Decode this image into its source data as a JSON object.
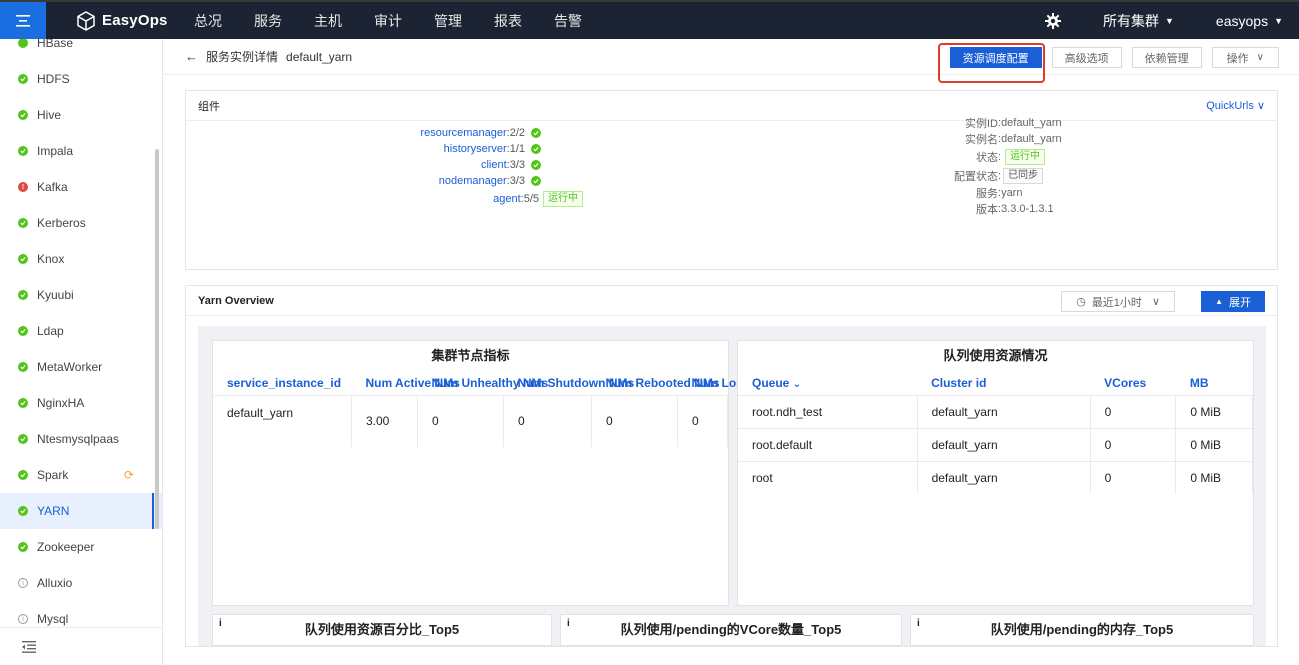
{
  "app": {
    "name": "EasyOps"
  },
  "nav": [
    "总况",
    "服务",
    "主机",
    "审计",
    "管理",
    "报表",
    "告警"
  ],
  "top_right": {
    "cluster": "所有集群",
    "user": "easyops"
  },
  "sidebar": {
    "items": [
      {
        "label": "HDFS",
        "status": "ok"
      },
      {
        "label": "Hive",
        "status": "ok"
      },
      {
        "label": "Impala",
        "status": "ok"
      },
      {
        "label": "Kafka",
        "status": "error"
      },
      {
        "label": "Kerberos",
        "status": "ok"
      },
      {
        "label": "Knox",
        "status": "ok"
      },
      {
        "label": "Kyuubi",
        "status": "ok"
      },
      {
        "label": "Ldap",
        "status": "ok"
      },
      {
        "label": "MetaWorker",
        "status": "ok"
      },
      {
        "label": "NginxHA",
        "status": "ok"
      },
      {
        "label": "Ntesmysqlpaas",
        "status": "ok"
      },
      {
        "label": "Spark",
        "status": "ok"
      },
      {
        "label": "YARN",
        "status": "ok",
        "active": true
      },
      {
        "label": "Zookeeper",
        "status": "ok"
      },
      {
        "label": "Alluxio",
        "status": "info"
      },
      {
        "label": "Mysql",
        "status": "info"
      }
    ]
  },
  "header": {
    "back_label": "服务实例详情",
    "instance": "default_yarn",
    "buttons": {
      "resource_config": "资源调度配置",
      "advanced": "高级选项",
      "dependency": "依赖管理",
      "operations": "操作"
    }
  },
  "components": {
    "title": "组件",
    "quickurls": "QuickUrls",
    "list": [
      {
        "name": "resourcemanager",
        "value": "2/2"
      },
      {
        "name": "historyserver",
        "value": "1/1"
      },
      {
        "name": "client",
        "value": "3/3"
      },
      {
        "name": "nodemanager",
        "value": "3/3"
      },
      {
        "name": "agent",
        "value": "5/5",
        "tag": "运行中"
      }
    ],
    "info": [
      {
        "key": "实例ID",
        "value": "default_yarn"
      },
      {
        "key": "实例名",
        "value": "default_yarn"
      },
      {
        "key": "状态",
        "tag": "运行中"
      },
      {
        "key": "配置状态",
        "tag": "已同步"
      },
      {
        "key": "服务",
        "value": "yarn"
      },
      {
        "key": "版本",
        "value": "3.3.0-1.3.1"
      }
    ]
  },
  "overview": {
    "title": "Yarn Overview",
    "time_range": "最近1小时",
    "expand": "展开",
    "cluster_metrics": {
      "title": "集群节点指标",
      "headers": [
        "service_instance_id",
        "Num Active NMs",
        "Num Unhealthy NMs",
        "Num Shutdown NMs",
        "Num Rebooted NMs",
        "Num Lost NMs"
      ],
      "rows": [
        [
          "default_yarn",
          "3.00",
          "0",
          "0",
          "0",
          "0"
        ]
      ]
    },
    "queue_usage": {
      "title": "队列使用资源情况",
      "headers": [
        "Queue",
        "Cluster id",
        "VCores",
        "MB"
      ],
      "rows": [
        [
          "root.ndh_test",
          "default_yarn",
          "0",
          "0 MiB"
        ],
        [
          "root.default",
          "default_yarn",
          "0",
          "0 MiB"
        ],
        [
          "root",
          "default_yarn",
          "0",
          "0 MiB"
        ]
      ]
    },
    "bottom_cards": [
      "队列使用资源百分比_Top5",
      "队列使用/pending的VCore数量_Top5",
      "队列使用/pending的内存_Top5"
    ]
  }
}
